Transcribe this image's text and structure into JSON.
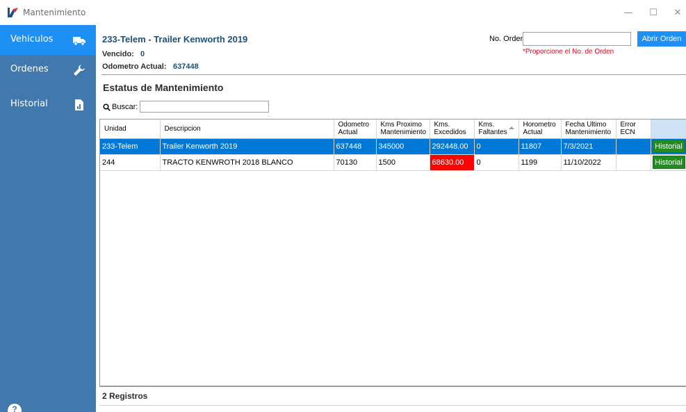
{
  "window": {
    "title": "Mantenimiento",
    "minimize": "—",
    "maximize": "☐",
    "close": "✕"
  },
  "sidebar": {
    "items": [
      {
        "label": "Vehiculos",
        "icon": "truck-icon",
        "active": true
      },
      {
        "label": "Ordenes",
        "icon": "wrench-icon",
        "active": false
      },
      {
        "label": "Historial",
        "icon": "report-icon",
        "active": false
      }
    ]
  },
  "header": {
    "title": "233-Telem  - Trailer Kenworth 2019",
    "vencido_label": "Vencido:",
    "vencido_value": "0",
    "odometro_label": "Odometro Actual:",
    "odometro_value": "637448",
    "orden_label": "No. Orden:",
    "orden_value": "",
    "orden_hint": "*Proporcione el No. de Orden",
    "abrir_label": "Abrir Orden"
  },
  "main": {
    "section_title": "Estatus de Mantenimiento",
    "search_label": "Buscar:",
    "search_value": ""
  },
  "table": {
    "columns": [
      "Unidad",
      "Descripcion",
      "Odometro\nActual",
      "Kms Proximo\nMantenimiento",
      "Kms.\nExcedidos",
      "Kms.\nFaltantes",
      "Horometro\nActual",
      "Fecha Ultimo\nMantenimiento",
      "Error\nECN",
      ""
    ],
    "rows": [
      {
        "unidad": "233-Telem",
        "descripcion": "Trailer Kenworth 2019",
        "odometro": "637448",
        "proximo": "345000",
        "excedidos": "292448.00",
        "faltantes": "0",
        "horometro": "11807",
        "fecha": "7/3/2021",
        "error": "",
        "action": "Historial",
        "selected": true
      },
      {
        "unidad": "244",
        "descripcion": "TRACTO KENWROTH 2018 BLANCO",
        "odometro": "70130",
        "proximo": "1500",
        "excedidos": "68630.00",
        "faltantes": "0",
        "horometro": "1199",
        "fecha": "11/10/2022",
        "error": "",
        "action": "Historial",
        "selected": false
      }
    ]
  },
  "footer": {
    "registros": "2 Registros"
  },
  "colors": {
    "sidebar": "#4178ad",
    "active": "#1e90f5",
    "selected_row": "#0078d7",
    "excess": "#ff0000",
    "historial_button": "#228b22",
    "hint": "#e0001b"
  }
}
